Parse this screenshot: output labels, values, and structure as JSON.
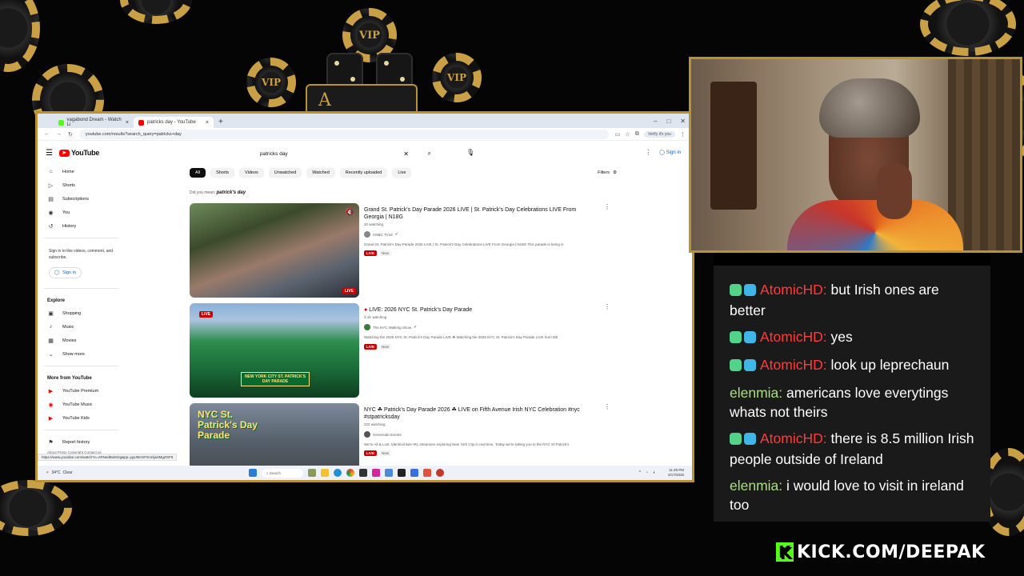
{
  "browser": {
    "tabs": [
      {
        "label": "vagabond Dream - Watch Li",
        "color": "#53fc18"
      },
      {
        "label": "patricks day - YouTube",
        "color": "#ff0000"
      }
    ],
    "new_tab": "+",
    "url": "youtube.com/results?search_query=patricks+day",
    "profile_pill": "Verify it's you"
  },
  "youtube": {
    "logo": "YouTube",
    "search_value": "patricks day",
    "sign_in": "Sign in",
    "guide": {
      "primary": [
        {
          "icon": "home-icon",
          "glyph": "⌂",
          "label": "Home"
        },
        {
          "icon": "shorts-icon",
          "glyph": "▷",
          "label": "Shorts"
        },
        {
          "icon": "subscriptions-icon",
          "glyph": "▤",
          "label": "Subscriptions"
        },
        {
          "icon": "you-icon",
          "glyph": "◉",
          "label": "You"
        },
        {
          "icon": "history-icon",
          "glyph": "↺",
          "label": "History"
        }
      ],
      "signin_msg": "Sign in to like videos, comment, and subscribe.",
      "signin_btn": "Sign in",
      "explore_title": "Explore",
      "explore": [
        {
          "icon": "shopping-icon",
          "glyph": "▣",
          "label": "Shopping"
        },
        {
          "icon": "music-icon",
          "glyph": "♪",
          "label": "Music"
        },
        {
          "icon": "movies-icon",
          "glyph": "▦",
          "label": "Movies"
        },
        {
          "icon": "chevron-down-icon",
          "glyph": "⌄",
          "label": "Show more"
        }
      ],
      "more_title": "More from YouTube",
      "more": [
        {
          "label": "YouTube Premium"
        },
        {
          "label": "YouTube Music"
        },
        {
          "label": "YouTube Kids"
        }
      ],
      "report": "Report history",
      "footer": "About  Press  Copyright  Contact us  Creators  Advertise  Developers"
    },
    "chips": [
      "All",
      "Shorts",
      "Videos",
      "Unwatched",
      "Watched",
      "Recently uploaded",
      "Live"
    ],
    "filters": "Filters",
    "did_you_mean_prefix": "Did you mean:",
    "did_you_mean_term": "patrick's day",
    "results": [
      {
        "title": "Grand St. Patrick's Day Parade 2026 LIVE | St. Patrick's Day Celebrations LIVE From Georgia | N18G",
        "meta": "20 watching",
        "channel": "CNBC TV18",
        "desc": "Grand St. Patrick's Day Parade 2026 LIVE | St. Patrick's Day Celebrations LIVE From Georgia | N18G This parade is being is",
        "live": "LIVE",
        "new": "New",
        "thumb_tag": "LIVE"
      },
      {
        "title": "LIVE: 2026 NYC St. Patrick's Day Parade",
        "meta": "3.1K watching",
        "channel": "The NYC Walking Show",
        "desc": "Watching the 2026 NYC St. Patrick's Day Parade LIVE ☘ Watching the 2026 NYC St. Patrick's Day Parade LIVE from 5th",
        "live": "LIVE",
        "new": "New",
        "thumb_tag": "LIVE",
        "thumb_caption": "NEW YORK CITY ST. PATRICK'S DAY PARADE"
      },
      {
        "title": "NYC ☘ Patrick's Day Parade 2026 ☘ LIVE on Fifth Avenue Irish NYC Celebration #nyc #stpatricksday",
        "meta": "222 watching",
        "channel": "Greenside Events",
        "desc": "We're All & Lost, Identical twin IRL streamers exploring New York City in real time. Today we're taking you to the NYC St Patrick's",
        "live": "LIVE",
        "new": "New",
        "thumb_caption": "NYC St. Patrick's Day Parade"
      }
    ],
    "status_url": "https://www.youtube.com/watch?v=ARNedBulKDg&pp=ygUMcGF0cmlja3MgZGF5"
  },
  "taskbar": {
    "weather_temp": "34°C",
    "weather_desc": "Clear",
    "search": "Search",
    "time": "11:49 PM",
    "date": "3/17/2026"
  },
  "chat": {
    "messages": [
      {
        "user": "AtomicHD",
        "text": "but Irish ones are better",
        "color": "red",
        "badges": true
      },
      {
        "user": "AtomicHD",
        "text": "yes",
        "color": "red",
        "badges": true
      },
      {
        "user": "AtomicHD",
        "text": "look up leprechaun",
        "color": "red",
        "badges": true
      },
      {
        "user": "elenmia",
        "text": "americans love everytings whats not theirs",
        "color": "green",
        "badges": false
      },
      {
        "user": "AtomicHD",
        "text": "there is 8.5 million Irish people outside of Ireland",
        "color": "red",
        "badges": true
      },
      {
        "user": "elenmia",
        "text": "i would love to visit in ireland too",
        "color": "green",
        "badges": false
      }
    ]
  },
  "overlay": {
    "chip_labels": [
      "VIP",
      "VIP",
      "VIP"
    ],
    "ace": "A",
    "kick_brand": "KICK.COM/DEEPAK",
    "kick_letter": "K"
  }
}
